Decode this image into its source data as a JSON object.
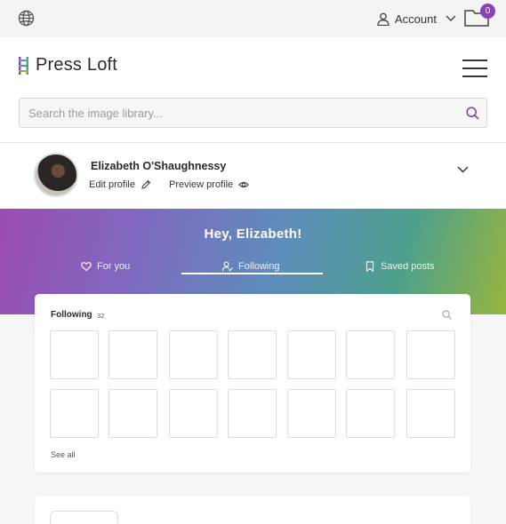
{
  "topbar": {
    "account_label": "Account",
    "cart_count": "0",
    "brand_color": "#8b3fb8"
  },
  "header": {
    "logo_text": "Press Loft",
    "search_placeholder": "Search the image library..."
  },
  "profile": {
    "name": "Elizabeth O'Shaughnessy",
    "edit_label": "Edit profile",
    "preview_label": "Preview profile"
  },
  "banner": {
    "greeting": "Hey, Elizabeth!",
    "tabs": [
      {
        "label": "For you",
        "icon": "heart-icon"
      },
      {
        "label": "Following",
        "icon": "user-check-icon",
        "active": true
      },
      {
        "label": "Saved posts",
        "icon": "bookmark-icon"
      }
    ]
  },
  "following": {
    "title": "Following",
    "count": "32",
    "see_all": "See all"
  }
}
